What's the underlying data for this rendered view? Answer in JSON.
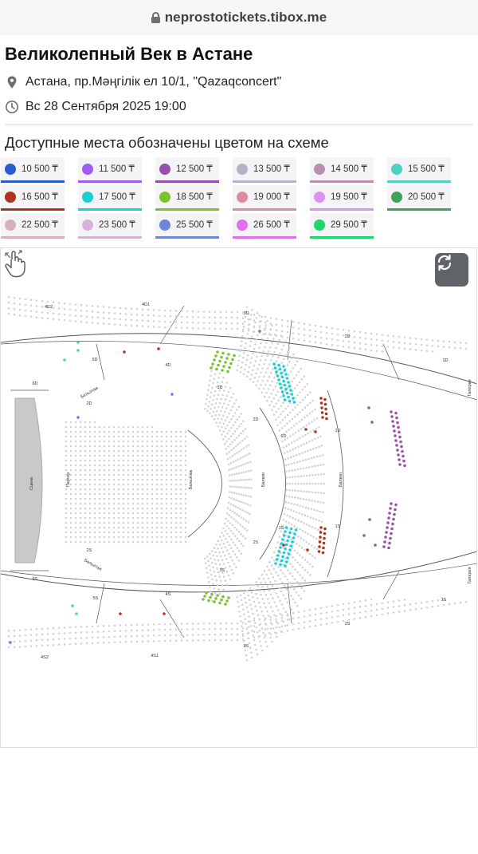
{
  "browser": {
    "host": "neprostotickets.tibox.me"
  },
  "event": {
    "title": "Великолепный Век в Астане",
    "address": "Астана, пр.Мәңгілік ел 10/1, \"Qazaqconcert\"",
    "datetime": "Вс 28 Сентября 2025 19:00"
  },
  "availability_note": "Доступные места обозначены цветом на схеме",
  "legend": [
    {
      "price": "10 500 ₸",
      "color": "#2a5bd0"
    },
    {
      "price": "11 500 ₸",
      "color": "#a25bf0"
    },
    {
      "price": "12 500 ₸",
      "color": "#9a4fa8"
    },
    {
      "price": "13 500 ₸",
      "color": "#b3b3c6"
    },
    {
      "price": "14 500 ₸",
      "color": "#bb8fae"
    },
    {
      "price": "15 500 ₸",
      "color": "#4fd1c1"
    },
    {
      "price": "16 500 ₸",
      "color": "#b0331d"
    },
    {
      "price": "17 500 ₸",
      "color": "#18cfd6"
    },
    {
      "price": "18 500 ₸",
      "color": "#7cc22c"
    },
    {
      "price": "19 000 ₸",
      "color": "#dd8b9e"
    },
    {
      "price": "19 500 ₸",
      "color": "#d992ef"
    },
    {
      "price": "20 500 ₸",
      "color": "#3fa35a"
    },
    {
      "price": "22 500 ₸",
      "color": "#d7b1b8"
    },
    {
      "price": "23 500 ₸",
      "color": "#d6b2d9"
    },
    {
      "price": "25 500 ₸",
      "color": "#6e85d8"
    },
    {
      "price": "26 500 ₸",
      "color": "#e070ee"
    },
    {
      "price": "29 500 ₸",
      "color": "#1ed46c"
    }
  ],
  "scheme": {
    "labels": {
      "stage": "Сцена",
      "parter": "Партер",
      "beletage": "Бельэтаж",
      "balcony": "Балкон",
      "gallery": "Галерея",
      "boxes": [
        "4D2",
        "4D1",
        "3D",
        "2D",
        "1D",
        "5D",
        "4D",
        "3D",
        "2D",
        "1D",
        "6D",
        "4S2",
        "4S1",
        "3S",
        "2S",
        "1S",
        "5S",
        "4S",
        "3S",
        "2S",
        "1S",
        "6S",
        "1D",
        "1S",
        "2D",
        "2S"
      ]
    }
  }
}
